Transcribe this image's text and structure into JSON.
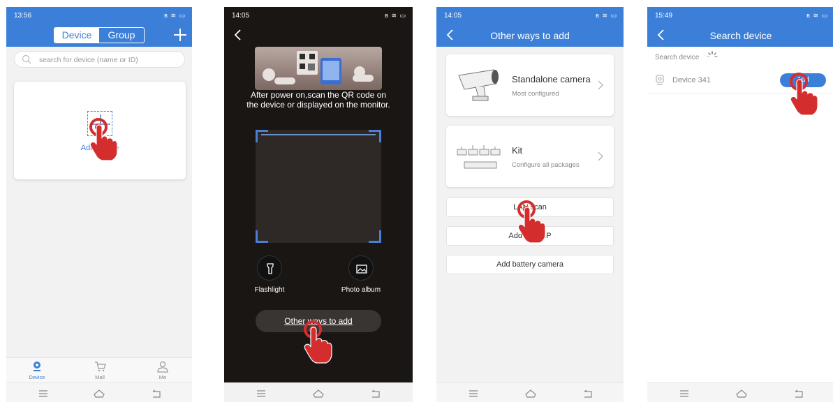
{
  "colors": {
    "accent": "#3b7fd9",
    "hand": "#d42d2d"
  },
  "panel1": {
    "time": "13:56",
    "tabs": [
      "Device",
      "Group"
    ],
    "search_placeholder": "search for device (name or ID)",
    "add_label": "Add device",
    "bottom_tabs": [
      "Device",
      "Mall",
      "Me"
    ]
  },
  "panel2": {
    "time": "14:05",
    "instruction": "After power on,scan the QR code on the device or displayed on the monitor.",
    "flashlight": "Flashlight",
    "photo_album": "Photo album",
    "other_ways": "Other ways to add"
  },
  "panel3": {
    "time": "14:05",
    "title": "Other ways to add",
    "options": [
      {
        "title": "Standalone camera",
        "subtitle": "Most configured"
      },
      {
        "title": "Kit",
        "subtitle": "Configure all packages"
      }
    ],
    "buttons": [
      "LAN scan",
      "Add by IP/IP",
      "Add battery camera"
    ]
  },
  "panel4": {
    "time": "15:49",
    "title": "Search device",
    "search_label": "Search device",
    "device_name": "Device 341",
    "add_button": "Add"
  }
}
